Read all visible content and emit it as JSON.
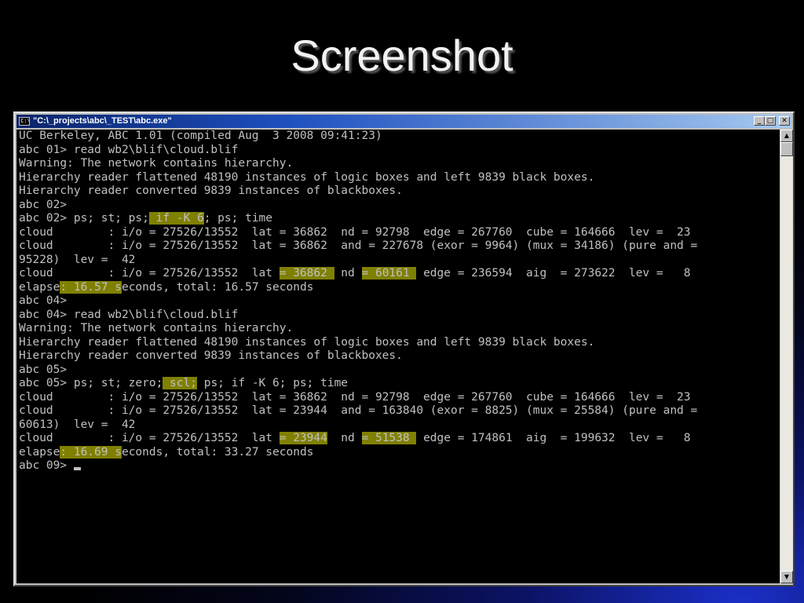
{
  "slide": {
    "title": "Screenshot"
  },
  "window": {
    "title": "\"C:\\_projects\\abc\\_TEST\\abc.exe\"",
    "icon_label": "C:\\",
    "buttons": {
      "minimize": "_",
      "maximize": "□",
      "close": "✕"
    }
  },
  "scrollbar": {
    "up_arrow": "▲",
    "down_arrow": "▼"
  },
  "console": {
    "lines": [
      [
        {
          "t": "UC Berkeley, ABC 1.01 (compiled Aug  3 2008 09:41:23)"
        }
      ],
      [
        {
          "t": "abc 01> read wb2\\blif\\cloud.blif"
        }
      ],
      [
        {
          "t": "Warning: The network contains hierarchy."
        }
      ],
      [
        {
          "t": "Hierarchy reader flattened 48190 instances of logic boxes and left 9839 black boxes."
        }
      ],
      [
        {
          "t": "Hierarchy reader converted 9839 instances of blackboxes."
        }
      ],
      [
        {
          "t": "abc 02>"
        }
      ],
      [
        {
          "t": "abc 02> ps; st; ps;"
        },
        {
          "t": " if -K 6",
          "h": true
        },
        {
          "t": "; ps; time"
        }
      ],
      [
        {
          "t": "cloud        : i/o = 27526/13552  lat = 36862  nd = 92798  edge = 267760  cube = 164666  lev =  23"
        }
      ],
      [
        {
          "t": "cloud        : i/o = 27526/13552  lat = 36862  and = 227678 (exor = 9964) (mux = 34186) (pure and ="
        }
      ],
      [
        {
          "t": "95228)  lev =  42"
        }
      ],
      [
        {
          "t": "cloud        : i/o = 27526/13552  lat "
        },
        {
          "t": "= 36862 ",
          "h": true
        },
        {
          "t": " nd "
        },
        {
          "t": "= 60161 ",
          "h": true
        },
        {
          "t": " edge = 236594  aig  = 273622  lev =   8"
        }
      ],
      [
        {
          "t": "elapse"
        },
        {
          "t": ": 16.57 s",
          "h": true
        },
        {
          "t": "econds, total: 16.57 seconds"
        }
      ],
      [
        {
          "t": "abc 04>"
        }
      ],
      [
        {
          "t": "abc 04> read wb2\\blif\\cloud.blif"
        }
      ],
      [
        {
          "t": "Warning: The network contains hierarchy."
        }
      ],
      [
        {
          "t": "Hierarchy reader flattened 48190 instances of logic boxes and left 9839 black boxes."
        }
      ],
      [
        {
          "t": "Hierarchy reader converted 9839 instances of blackboxes."
        }
      ],
      [
        {
          "t": "abc 05>"
        }
      ],
      [
        {
          "t": "abc 05> ps; st; zero;"
        },
        {
          "t": " scl;",
          "h": true
        },
        {
          "t": " ps; if -K 6; ps; time"
        }
      ],
      [
        {
          "t": "cloud        : i/o = 27526/13552  lat = 36862  nd = 92798  edge = 267760  cube = 164666  lev =  23"
        }
      ],
      [
        {
          "t": "cloud        : i/o = 27526/13552  lat = 23944  and = 163840 (exor = 8825) (mux = 25584) (pure and ="
        }
      ],
      [
        {
          "t": "60613)  lev =  42"
        }
      ],
      [
        {
          "t": "cloud        : i/o = 27526/13552  lat "
        },
        {
          "t": "= 23944",
          "h": true
        },
        {
          "t": "  nd "
        },
        {
          "t": "= 51538 ",
          "h": true
        },
        {
          "t": " edge = 174861  aig  = 199632  lev =   8"
        }
      ],
      [
        {
          "t": "elapse"
        },
        {
          "t": ": 16.69 s",
          "h": true
        },
        {
          "t": "econds, total: 33.27 seconds"
        }
      ],
      [
        {
          "t": "abc 09> "
        }
      ]
    ]
  }
}
